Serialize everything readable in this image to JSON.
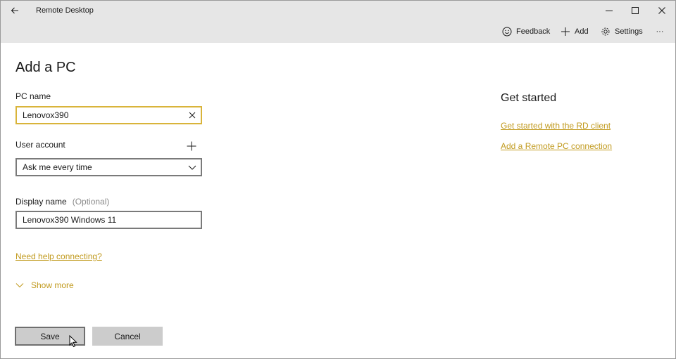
{
  "window": {
    "title": "Remote Desktop"
  },
  "command_bar": {
    "feedback_label": "Feedback",
    "add_label": "Add",
    "settings_label": "Settings",
    "more_label": "···"
  },
  "form": {
    "title": "Add a PC",
    "pc_name": {
      "label": "PC name",
      "value": "Lenovox390"
    },
    "user_account": {
      "label": "User account",
      "value": "Ask me every time"
    },
    "display_name": {
      "label": "Display name",
      "optional": "(Optional)",
      "value": "Lenovox390 Windows 11"
    },
    "help_link": "Need help connecting?",
    "show_more": "Show more",
    "save_label": "Save",
    "cancel_label": "Cancel"
  },
  "side_panel": {
    "title": "Get started",
    "links": [
      "Get started with the RD client",
      "Add a Remote PC connection"
    ]
  },
  "colors": {
    "accent": "#c19a1e",
    "focus_border": "#d9b43a",
    "chrome_bg": "#e6e6e6",
    "button_bg": "#cccccc"
  }
}
